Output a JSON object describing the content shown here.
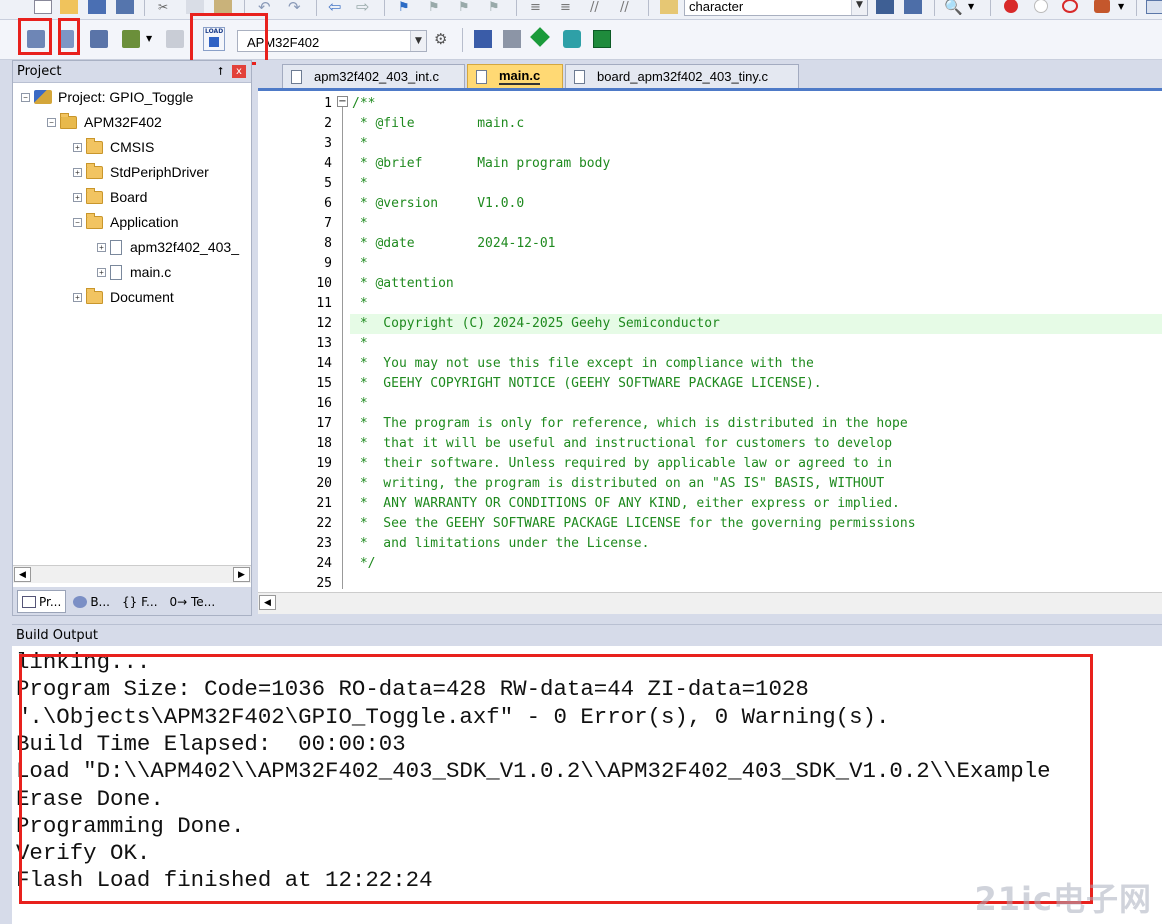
{
  "toolbar_top": {
    "find_text": "character"
  },
  "toolbar_build": {
    "target_name": "APM32F402",
    "load_icon_text": "LOAD"
  },
  "project_panel": {
    "title": "Project",
    "pin_symbol": "⭡",
    "close_symbol": "x",
    "tree": [
      {
        "label": "Project: GPIO_Toggle",
        "expander": "−"
      },
      {
        "label": "APM32F402",
        "expander": "−"
      },
      {
        "label": "CMSIS",
        "expander": "+"
      },
      {
        "label": "StdPeriphDriver",
        "expander": "+"
      },
      {
        "label": "Board",
        "expander": "+"
      },
      {
        "label": "Application",
        "expander": "−"
      },
      {
        "label": "apm32f402_403_",
        "expander": "+"
      },
      {
        "label": "main.c",
        "expander": "+"
      },
      {
        "label": "Document",
        "expander": "+"
      }
    ],
    "tabs": [
      "Pr...",
      "B...",
      "{} F...",
      "0→ Te..."
    ]
  },
  "editor": {
    "tabs": [
      {
        "label": "apm32f402_403_int.c",
        "active": false
      },
      {
        "label": "main.c",
        "active": true
      },
      {
        "label": "board_apm32f402_403_tiny.c",
        "active": false
      }
    ],
    "highlighted_line": 12,
    "comment_color": "#1f8a1f",
    "lines": [
      "/**",
      " * @file        main.c",
      " *",
      " * @brief       Main program body",
      " *",
      " * @version     V1.0.0",
      " *",
      " * @date        2024-12-01",
      " *",
      " * @attention",
      " *",
      " *  Copyright (C) 2024-2025 Geehy Semiconductor",
      " *",
      " *  You may not use this file except in compliance with the",
      " *  GEEHY COPYRIGHT NOTICE (GEEHY SOFTWARE PACKAGE LICENSE).",
      " *",
      " *  The program is only for reference, which is distributed in the hope",
      " *  that it will be useful and instructional for customers to develop",
      " *  their software. Unless required by applicable law or agreed to in",
      " *  writing, the program is distributed on an \"AS IS\" BASIS, WITHOUT",
      " *  ANY WARRANTY OR CONDITIONS OF ANY KIND, either express or implied.",
      " *  See the GEEHY SOFTWARE PACKAGE LICENSE for the governing permissions",
      " *  and limitations under the License.",
      " */",
      ""
    ],
    "line_numbers": [
      "1",
      "2",
      "3",
      "4",
      "5",
      "6",
      "7",
      "8",
      "9",
      "10",
      "11",
      "12",
      "13",
      "14",
      "15",
      "16",
      "17",
      "18",
      "19",
      "20",
      "21",
      "22",
      "23",
      "24",
      "25"
    ]
  },
  "build_output": {
    "title": "Build Output",
    "lines": [
      "linking...",
      "Program Size: Code=1036 RO-data=428 RW-data=44 ZI-data=1028",
      "\".\\Objects\\APM32F402\\GPIO_Toggle.axf\" - 0 Error(s), 0 Warning(s).",
      "Build Time Elapsed:  00:00:03",
      "Load \"D:\\\\APM402\\\\APM32F402_403_SDK_V1.0.2\\\\APM32F402_403_SDK_V1.0.2\\\\Example",
      "Erase Done.",
      "Programming Done.",
      "Verify OK.",
      "Flash Load finished at 12:22:24"
    ]
  },
  "watermark": "21ic电子网",
  "colors": {
    "highlight_box": "#e8211d",
    "active_tab": "#ffd974",
    "panel_bg": "#d6dbe9"
  }
}
